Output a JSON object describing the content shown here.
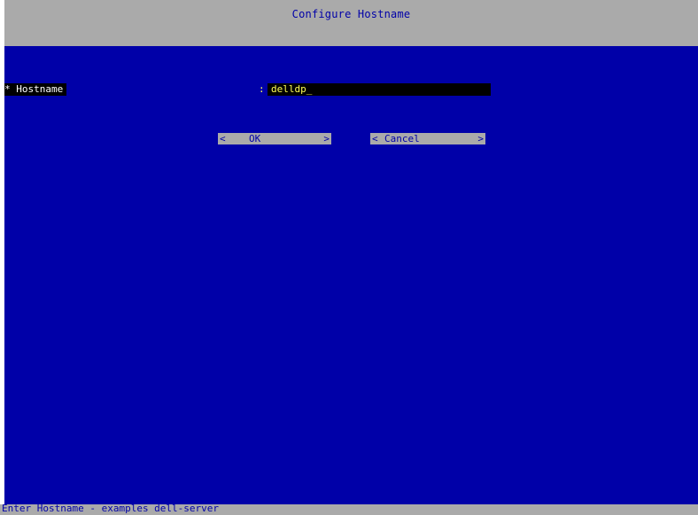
{
  "window": {
    "title": "Configure Hostname"
  },
  "form": {
    "field_label": "* Hostname",
    "field_separator": ":",
    "field_value": "delldp_"
  },
  "buttons": {
    "ok_left": "<",
    "ok_label": "OK",
    "ok_right": ">",
    "cancel_left": "<",
    "cancel_label": "Cancel",
    "cancel_right": ">"
  },
  "status": {
    "hint": "Enter Hostname - examples dell-server"
  },
  "colors": {
    "screen_background": "#0000a8",
    "bar_background": "#aaaaaa",
    "input_text": "#ffff55",
    "label_text": "#ffffff"
  }
}
